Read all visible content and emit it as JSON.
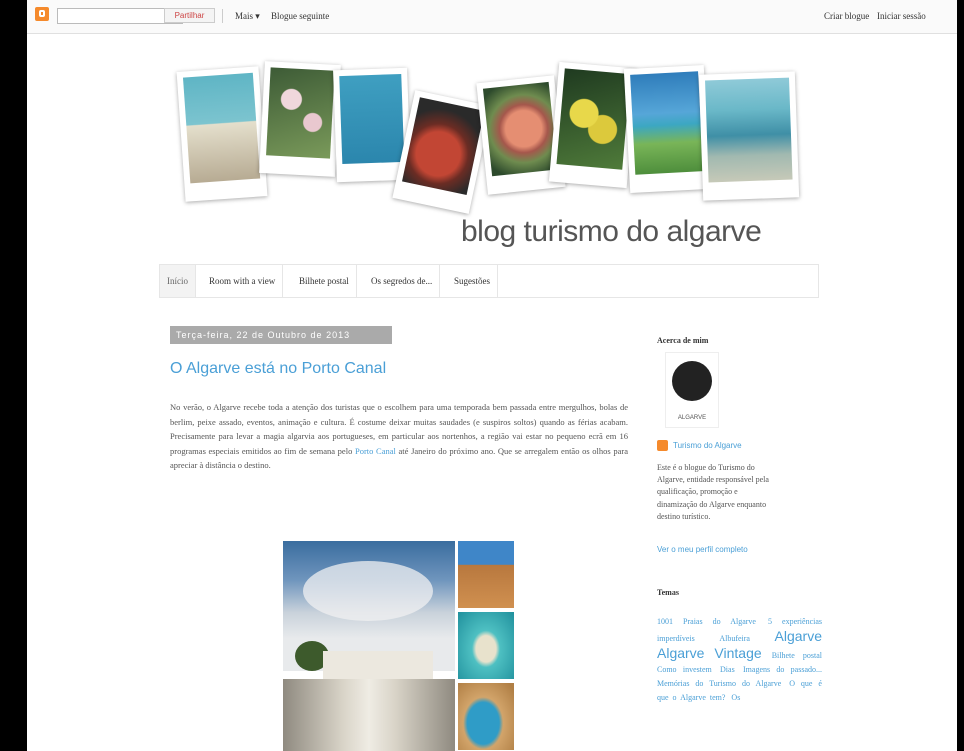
{
  "navbar": {
    "share_label": "Partilhar",
    "more_label": "Mais ▾",
    "next_blog_label": "Blogue seguinte",
    "create_blog_label": "Criar blogue",
    "sign_in_label": "Iniciar sessão"
  },
  "blog": {
    "title": "blog turismo do algarve"
  },
  "tabs": [
    {
      "label": "Início"
    },
    {
      "label": "Room with a view"
    },
    {
      "label": "Bilhete postal"
    },
    {
      "label": "Os segredos de..."
    },
    {
      "label": "Sugestões"
    }
  ],
  "post": {
    "date": "Terça-feira, 22 de Outubro de 2013",
    "title": "O Algarve está no Porto Canal",
    "body_pre": "No verão, o Algarve recebe toda a atenção dos turistas que o escolhem para uma temporada bem passada entre mergulhos, bolas de berlim, peixe assado, eventos, animação e cultura. É costume deixar muitas saudades (e suspiros soltos) quando as férias acabam. Precisamente para levar a magia algarvia aos portugueses, em particular aos nortenhos, a região vai estar no pequeno ecrã em 16 programas especiais emitidos ao fim de semana pelo ",
    "body_link": "Porto Canal",
    "body_post": " até Janeiro do próximo ano. Que se arregalem então os olhos para apreciar à distância o destino."
  },
  "sidebar": {
    "about_heading": "Acerca de mim",
    "avatar_caption": "ALGARVE",
    "profile_name": "Turismo do Algarve",
    "about_text": "Este é o blogue do Turismo do Algarve, entidade responsável pela qualificação, promoção e dinamização do Algarve enquanto destino turístico.",
    "view_profile": "Ver o meu perfil completo",
    "themes_heading": "Temas",
    "tags": [
      {
        "text": "1001 Praias do Algarve",
        "size": "s"
      },
      {
        "text": "5 experiências imperdíveis",
        "size": "s"
      },
      {
        "text": "Albufeira",
        "size": "s"
      },
      {
        "text": "Algarve",
        "size": "l"
      },
      {
        "text": "Algarve Vintage",
        "size": "l"
      },
      {
        "text": "Bilhete postal",
        "size": "s"
      },
      {
        "text": "Como investem",
        "size": "s"
      },
      {
        "text": "Dias",
        "size": "s"
      },
      {
        "text": "Imagens do passado...",
        "size": "s"
      },
      {
        "text": "Memórias do Turismo do Algarve",
        "size": "s"
      },
      {
        "text": "O que é que o Algarve tem?",
        "size": "s"
      },
      {
        "text": "Os",
        "size": "s"
      }
    ]
  },
  "colors": {
    "link": "#4a9fd6",
    "blogger_orange": "#f58a2c",
    "date_bg": "#aaaaaa"
  }
}
